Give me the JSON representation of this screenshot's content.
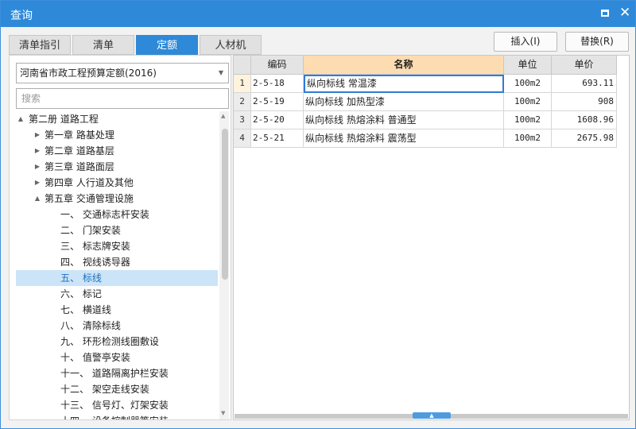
{
  "window": {
    "title": "查询"
  },
  "tabs": [
    {
      "label": "清单指引",
      "active": false
    },
    {
      "label": "清单",
      "active": false
    },
    {
      "label": "定额",
      "active": true
    },
    {
      "label": "人材机",
      "active": false
    }
  ],
  "actions": {
    "insert_label": "插入(I)",
    "replace_label": "替换(R)"
  },
  "left": {
    "selected_library": "河南省市政工程预算定额(2016)",
    "search_placeholder": "搜索",
    "tree": [
      {
        "label": "第二册 道路工程",
        "twisty": "▲"
      },
      {
        "label": "第一章 路基处理",
        "twisty": "▶"
      },
      {
        "label": "第二章 道路基层",
        "twisty": "▶"
      },
      {
        "label": "第三章 道路面层",
        "twisty": "▶"
      },
      {
        "label": "第四章 人行道及其他",
        "twisty": "▶"
      },
      {
        "label": "第五章 交通管理设施",
        "twisty": "▲"
      },
      {
        "label": "一、 交通标志杆安装",
        "twisty": ""
      },
      {
        "label": "二、 门架安装",
        "twisty": ""
      },
      {
        "label": "三、 标志牌安装",
        "twisty": ""
      },
      {
        "label": "四、 视线诱导器",
        "twisty": ""
      },
      {
        "label": "五、 标线",
        "twisty": "",
        "selected": true
      },
      {
        "label": "六、 标记",
        "twisty": ""
      },
      {
        "label": "七、 横道线",
        "twisty": ""
      },
      {
        "label": "八、 清除标线",
        "twisty": ""
      },
      {
        "label": "九、 环形检测线圈敷设",
        "twisty": ""
      },
      {
        "label": "十、 值警亭安装",
        "twisty": ""
      },
      {
        "label": "十一、 道路隔离护栏安装",
        "twisty": ""
      },
      {
        "label": "十二、 架空走线安装",
        "twisty": ""
      },
      {
        "label": "十三、 信号灯、灯架安装",
        "twisty": ""
      },
      {
        "label": "十四、 设备控制器等安装",
        "twisty": ""
      }
    ]
  },
  "table": {
    "headers": {
      "code": "编码",
      "name": "名称",
      "unit": "单位",
      "price": "单价"
    },
    "rows": [
      {
        "num": "1",
        "code": "2-5-18",
        "name": "纵向标线 常温漆",
        "unit": "100m2",
        "price": "693.11"
      },
      {
        "num": "2",
        "code": "2-5-19",
        "name": "纵向标线 加热型漆",
        "unit": "100m2",
        "price": "908"
      },
      {
        "num": "3",
        "code": "2-5-20",
        "name": "纵向标线 热熔涂料 普通型",
        "unit": "100m2",
        "price": "1608.96"
      },
      {
        "num": "4",
        "code": "2-5-21",
        "name": "纵向标线 热熔涂料 震荡型",
        "unit": "100m2",
        "price": "2675.98"
      }
    ]
  }
}
